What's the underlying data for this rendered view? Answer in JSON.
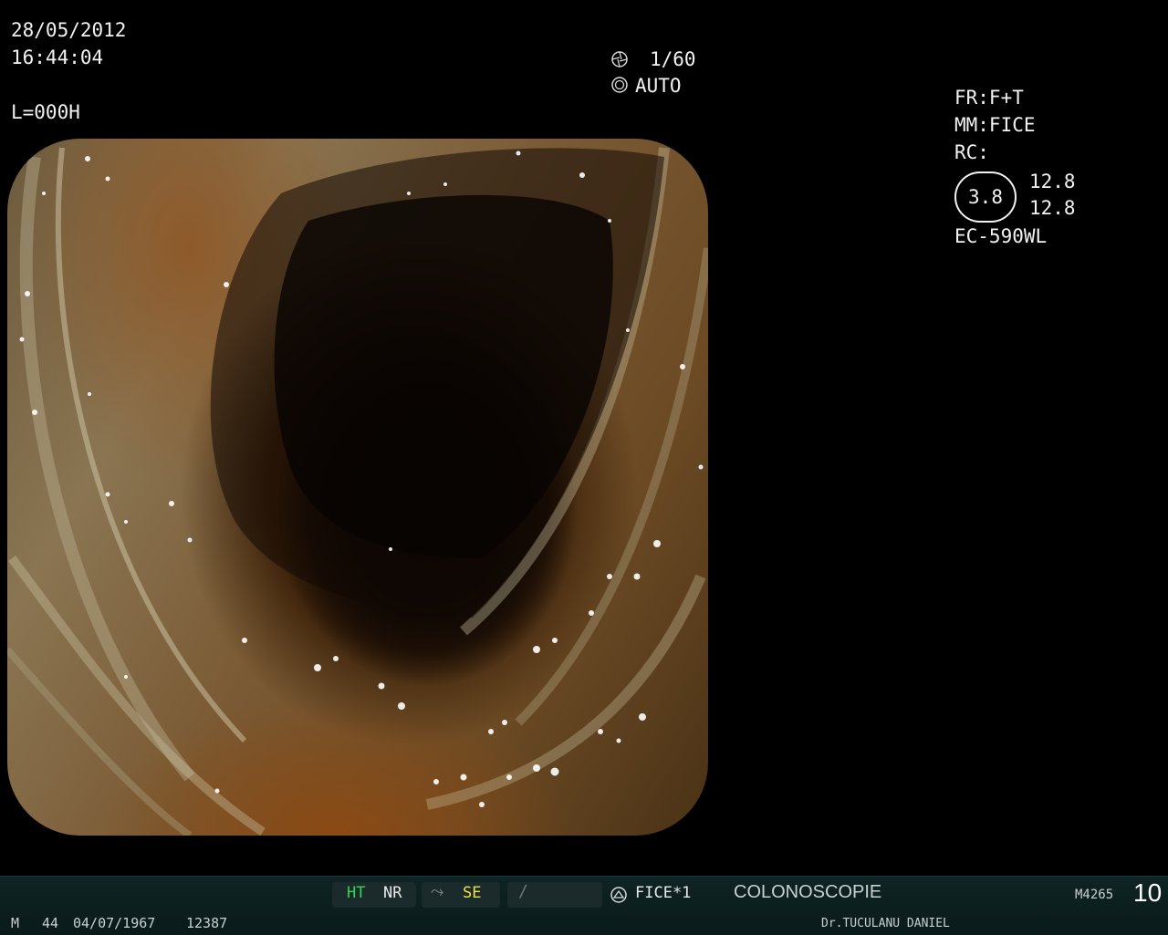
{
  "overlay": {
    "date": "28/05/2012",
    "time": "16:44:04",
    "length": "L=000H",
    "shutter": "1/60",
    "iris": "AUTO",
    "fr": "FR:F+T",
    "mm": "MM:FICE",
    "rc": "RC:",
    "rc_value": "3.8",
    "rc_right_top": "12.8",
    "rc_right_bottom": "12.8",
    "scope_model": "EC-590WL"
  },
  "status_bar": {
    "ht": "HT",
    "nr": "NR",
    "se": "SE",
    "fice": "FICE*1",
    "procedure": "COLONOSCOPIE",
    "code": "M4265",
    "number": "10",
    "sex": "M",
    "age": "44",
    "dob": "04/07/1967",
    "patient_id": "12387",
    "doctor": "Dr.TUCULANU DANIEL"
  },
  "colors": {
    "text": "#f2f2f2",
    "ht_green": "#39d353",
    "se_yellow": "#f0e040",
    "status_bg": "#0f2424"
  }
}
